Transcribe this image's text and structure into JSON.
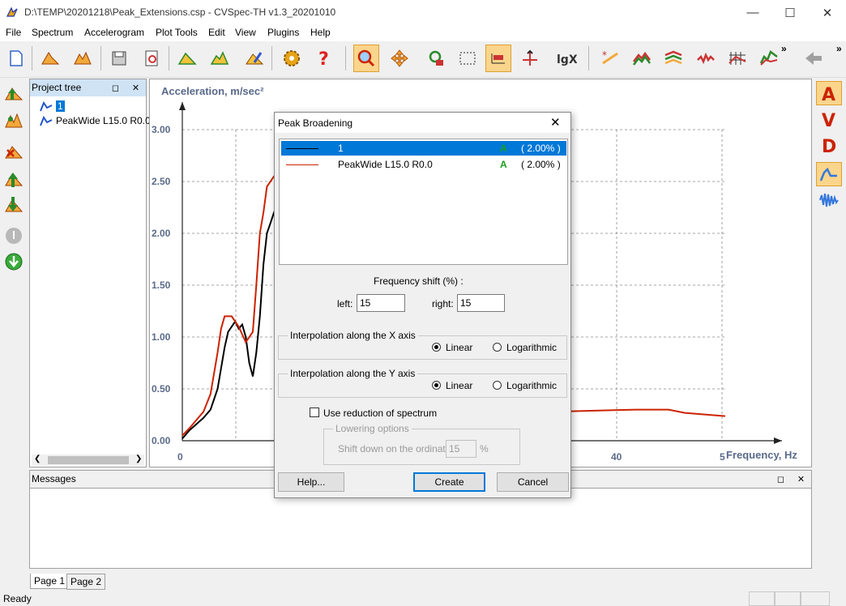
{
  "window": {
    "title": "D:\\TEMP\\20201218\\Peak_Extensions.csp - CVSpec-TH  v1.3_20201010"
  },
  "menu": [
    "File",
    "Spectrum",
    "Accelerogram",
    "Plot Tools",
    "Edit",
    "View",
    "Plugins",
    "Help"
  ],
  "project_tree": {
    "title": "Project tree",
    "items": [
      "1",
      "PeakWide L15.0 R0.0"
    ]
  },
  "chart": {
    "y_axis_label": "Acceleration, m/sec²",
    "x_axis_label": "Frequency, Hz",
    "y_ticks": [
      "0.00",
      "0.50",
      "1.00",
      "1.50",
      "2.00",
      "2.50",
      "3.00"
    ],
    "x_ticks": [
      "0",
      "40",
      "5"
    ],
    "colors": {
      "series1": "#000000",
      "series2": "#cc2200",
      "grid": "#888888"
    }
  },
  "chart_data": {
    "type": "line",
    "xlabel": "Frequency, Hz",
    "ylabel": "Acceleration, m/sec²",
    "ylim": [
      0,
      3.0
    ],
    "grid": true,
    "series": [
      {
        "name": "1",
        "color": "#000000",
        "x": [
          0,
          1,
          2,
          3,
          4,
          5,
          6,
          6.5,
          7,
          7.5,
          8,
          8.5,
          9,
          9.5,
          10,
          10.5,
          11,
          11.5,
          12,
          12.5,
          13,
          14,
          15
        ],
        "y": [
          0.02,
          0.1,
          0.16,
          0.22,
          0.3,
          0.5,
          0.9,
          1.05,
          1.1,
          1.15,
          1.08,
          1.12,
          1.0,
          0.75,
          0.62,
          0.85,
          1.2,
          1.7,
          2.0,
          2.1,
          2.2,
          2.35,
          2.5
        ]
      },
      {
        "name": "PeakWide L15.0 R0.0",
        "color": "#cc2200",
        "x": [
          0,
          1,
          2,
          3,
          4,
          5,
          5.5,
          6,
          7,
          8,
          9,
          10,
          10.5,
          11,
          11.5,
          12,
          13,
          14,
          15
        ],
        "y": [
          0.05,
          0.12,
          0.2,
          0.28,
          0.45,
          0.85,
          1.08,
          1.2,
          1.2,
          1.1,
          0.95,
          1.05,
          1.5,
          2.0,
          2.2,
          2.45,
          2.55,
          2.55,
          2.55
        ]
      }
    ],
    "tail_y_approx": 0.3
  },
  "messages": {
    "title": "Messages"
  },
  "tabs": [
    "Page 1",
    "Page 2"
  ],
  "status": "Ready",
  "dialog": {
    "title": "Peak Broadening",
    "list": [
      {
        "name": "1",
        "flag": "A",
        "pct": "(  2.00%  )",
        "color": "#000000"
      },
      {
        "name": "PeakWide L15.0 R0.0",
        "flag": "A",
        "pct": "(  2.00%  )",
        "color": "#cc2200"
      }
    ],
    "freq_shift_label": "Frequency shift (%) :",
    "left_label": "left:",
    "left_value": "15",
    "right_label": "right:",
    "right_value": "15",
    "interp_x": {
      "title": "Interpolation along the X axis",
      "linear": "Linear",
      "log": "Logarithmic",
      "selected": "linear"
    },
    "interp_y": {
      "title": "Interpolation along the Y axis",
      "linear": "Linear",
      "log": "Logarithmic",
      "selected": "linear"
    },
    "use_reduction_label": "Use reduction of spectrum",
    "lowering_title": "Lowering options",
    "shift_down_label": "Shift down on the ordinate",
    "shift_down_value": "15",
    "shift_down_unit": "%",
    "buttons": {
      "help": "Help...",
      "create": "Create",
      "cancel": "Cancel"
    }
  }
}
